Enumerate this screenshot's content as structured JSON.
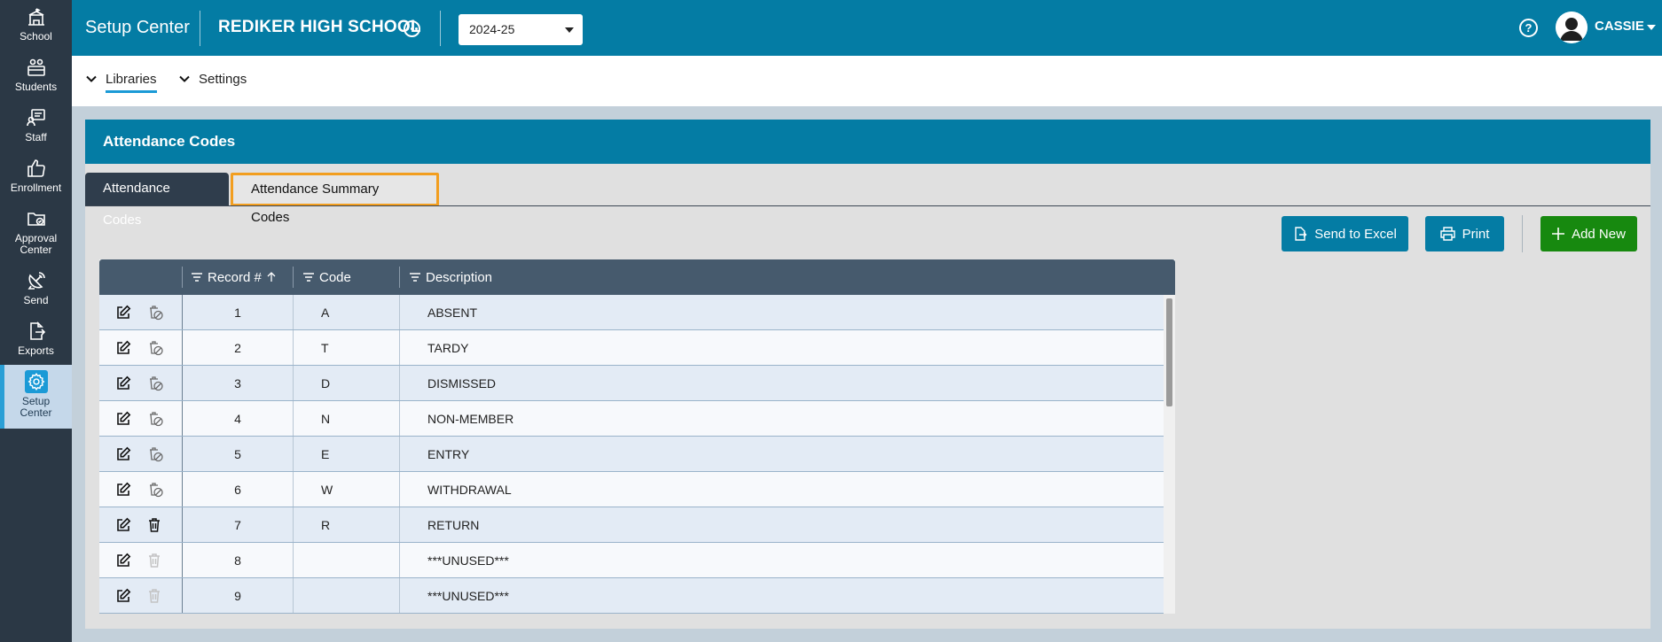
{
  "nav": {
    "items": [
      {
        "label": "School",
        "icon": "school-building-icon"
      },
      {
        "label": "Students",
        "icon": "students-icon"
      },
      {
        "label": "Staff",
        "icon": "staff-icon"
      },
      {
        "label": "Enrollment",
        "icon": "thumbs-up-icon"
      },
      {
        "label": "Approval Center",
        "icon": "folder-check-icon"
      },
      {
        "label": "Send",
        "icon": "satellite-dish-icon"
      },
      {
        "label": "Exports",
        "icon": "export-file-icon"
      },
      {
        "label": "Setup Center",
        "icon": "gear-icon",
        "active": true
      }
    ]
  },
  "header": {
    "app_title": "Setup Center",
    "school_name": "REDIKER HIGH SCHOOL",
    "school_year": "2024-25",
    "user_name": "CASSIE"
  },
  "subnav": {
    "libraries": "Libraries",
    "settings": "Settings"
  },
  "panel": {
    "title": "Attendance Codes",
    "tabs": [
      "Attendance Codes",
      "Attendance Summary Codes"
    ],
    "buttons": {
      "excel": "Send to Excel",
      "print": "Print",
      "add": "Add New"
    },
    "columns": [
      "Record #",
      "Code",
      "Description"
    ],
    "rows": [
      {
        "record": "1",
        "code": "A",
        "description": "ABSENT",
        "delete": "disabled-outline"
      },
      {
        "record": "2",
        "code": "T",
        "description": "TARDY",
        "delete": "disabled-outline"
      },
      {
        "record": "3",
        "code": "D",
        "description": "DISMISSED",
        "delete": "disabled-outline"
      },
      {
        "record": "4",
        "code": "N",
        "description": "NON-MEMBER",
        "delete": "disabled-outline"
      },
      {
        "record": "5",
        "code": "E",
        "description": "ENTRY",
        "delete": "disabled-outline"
      },
      {
        "record": "6",
        "code": "W",
        "description": "WITHDRAWAL",
        "delete": "disabled-outline"
      },
      {
        "record": "7",
        "code": "R",
        "description": "RETURN",
        "delete": "trash"
      },
      {
        "record": "8",
        "code": "",
        "description": "***UNUSED***",
        "delete": "trash-faded"
      },
      {
        "record": "9",
        "code": "",
        "description": "***UNUSED***",
        "delete": "trash-faded"
      }
    ]
  },
  "colors": {
    "header_blue": "#047ca4",
    "nav_dark": "#2b3845",
    "add_green": "#17890f",
    "focus_orange": "#f29e1f"
  }
}
